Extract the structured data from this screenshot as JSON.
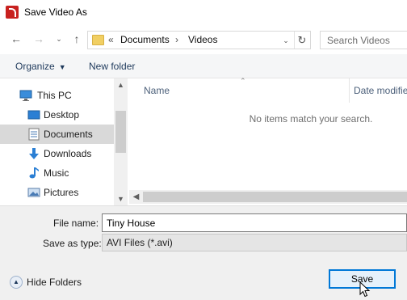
{
  "window": {
    "title": "Save Video As"
  },
  "address": {
    "crumb_prefix": "«",
    "crumbs": [
      "Documents",
      "Videos"
    ],
    "separator": "›"
  },
  "search": {
    "placeholder": "Search Videos"
  },
  "toolbar": {
    "organize_label": "Organize",
    "new_folder_label": "New folder"
  },
  "nav": {
    "items": [
      {
        "label": "This PC",
        "icon": "pc-icon"
      },
      {
        "label": "Desktop",
        "icon": "desktop-icon"
      },
      {
        "label": "Documents",
        "icon": "documents-icon",
        "selected": true
      },
      {
        "label": "Downloads",
        "icon": "download-arrow-icon"
      },
      {
        "label": "Music",
        "icon": "music-note-icon"
      },
      {
        "label": "Pictures",
        "icon": "pictures-icon"
      }
    ]
  },
  "content": {
    "columns": [
      "Name",
      "Date modified"
    ],
    "empty_message": "No items match your search."
  },
  "form": {
    "file_name_label": "File name:",
    "file_name_value": "Tiny House",
    "save_type_label": "Save as type:",
    "save_type_value": "AVI Files (*.avi)"
  },
  "footer": {
    "hide_folders_label": "Hide Folders",
    "save_label": "Save"
  },
  "colors": {
    "accent": "#0078d7",
    "selection": "#d9d9d9",
    "app_icon": "#c8211f"
  }
}
